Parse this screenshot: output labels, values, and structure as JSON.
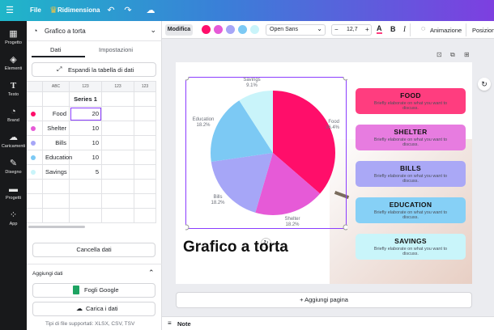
{
  "topbar": {
    "file_label": "File",
    "resize_label": "Ridimensiona",
    "icons": [
      "menu-icon",
      "crown-icon",
      "undo-icon",
      "redo-icon",
      "cloud-icon"
    ]
  },
  "rail": [
    {
      "label": "Progetto",
      "icon": "layout-icon"
    },
    {
      "label": "Elementi",
      "icon": "shapes-icon"
    },
    {
      "label": "Testo",
      "icon": "text-icon"
    },
    {
      "label": "Brand",
      "icon": "brand-icon"
    },
    {
      "label": "Caricamenti",
      "icon": "upload-icon"
    },
    {
      "label": "Disegno",
      "icon": "draw-icon"
    },
    {
      "label": "Progetti",
      "icon": "folder-icon"
    },
    {
      "label": "App",
      "icon": "apps-icon"
    }
  ],
  "panel": {
    "chart_selector": "Grafico a torta",
    "tabs": [
      "Dati",
      "Impostazioni"
    ],
    "expand_button": "Espandi la tabella di dati",
    "col_headers": [
      "ABC",
      "123",
      "123",
      "123"
    ],
    "series_header": "Series 1",
    "rows": [
      {
        "label": "Food",
        "value": "20",
        "color": "#ff0e6a"
      },
      {
        "label": "Shelter",
        "value": "10",
        "color": "#e65ad7"
      },
      {
        "label": "Bills",
        "value": "10",
        "color": "#a6a6f7"
      },
      {
        "label": "Education",
        "value": "10",
        "color": "#7cc9f4"
      },
      {
        "label": "Savings",
        "value": "5",
        "color": "#c9f4fa"
      }
    ],
    "clear_button": "Cancella dati",
    "add_data_label": "Aggiungi dati",
    "google_sheets_button": "Fogli Google",
    "upload_button": "Carica i dati",
    "supported_types": "Tipi di file supportati: XLSX, CSV, TSV"
  },
  "toolbar": {
    "edit_label": "Modifica",
    "swatches": [
      "#ff0e6a",
      "#e65ad7",
      "#a6a6f7",
      "#7cc9f4",
      "#c9f4fa"
    ],
    "font_name": "Open Sans",
    "font_size": "12,7",
    "minus": "−",
    "plus": "+",
    "text_color_glyph": "A",
    "bold": "B",
    "italic": "I",
    "animation_label": "Animazione",
    "position_label": "Posizione"
  },
  "canvas": {
    "title": "Grafico a torta",
    "add_page": "+ Aggiungi pagina",
    "notes_label": "Note"
  },
  "chart_data": {
    "type": "pie",
    "slices": [
      {
        "name": "Food",
        "value": 36.4,
        "label_pct": "36.4%",
        "color": "#ff0e6a"
      },
      {
        "name": "Shelter",
        "value": 18.2,
        "label_pct": "18.2%",
        "color": "#e65ad7"
      },
      {
        "name": "Bills",
        "value": 18.2,
        "label_pct": "18.2%",
        "color": "#a6a6f7"
      },
      {
        "name": "Education",
        "value": 18.2,
        "label_pct": "18.2%",
        "color": "#7cc9f4"
      },
      {
        "name": "Savings",
        "value": 9.1,
        "label_pct": "9.1%",
        "color": "#c9f4fa"
      }
    ]
  },
  "cards": [
    {
      "title": "FOOD",
      "desc": "Briefly elaborate on what you want to discuss.",
      "color": "#ff3d7f"
    },
    {
      "title": "SHELTER",
      "desc": "Briefly elaborate on what you want to discuss.",
      "color": "#e77ce0"
    },
    {
      "title": "BILLS",
      "desc": "Briefly elaborate on what you want to discuss.",
      "color": "#aaa8f6"
    },
    {
      "title": "EDUCATION",
      "desc": "Briefly elaborate on what you want to discuss.",
      "color": "#86d0f6"
    },
    {
      "title": "SAVINGS",
      "desc": "Briefly elaborate on what you want to discuss.",
      "color": "#c9f5fa"
    }
  ]
}
